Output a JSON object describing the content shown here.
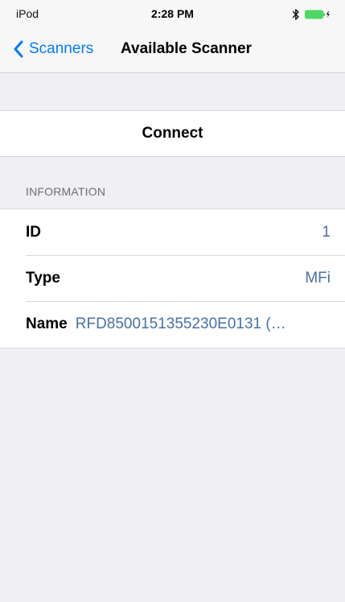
{
  "status_bar": {
    "carrier": "iPod",
    "time": "2:28 PM",
    "bluetooth_icon": "bluetooth-icon",
    "battery_icon": "battery-charging-icon"
  },
  "nav": {
    "back_label": "Scanners",
    "back_icon": "chevron-left-icon",
    "title": "Available Scanner",
    "accent": "#007aff"
  },
  "actions": {
    "connect_label": "Connect"
  },
  "information": {
    "header": "INFORMATION",
    "rows": [
      {
        "label": "ID",
        "value": "1"
      },
      {
        "label": "Type",
        "value": "MFi"
      },
      {
        "label": "Name",
        "value": "RFD8500151355230E0131 (…"
      }
    ]
  },
  "colors": {
    "background": "#efeff4",
    "value_text": "#4a6fa5",
    "battery": "#4cd964"
  }
}
